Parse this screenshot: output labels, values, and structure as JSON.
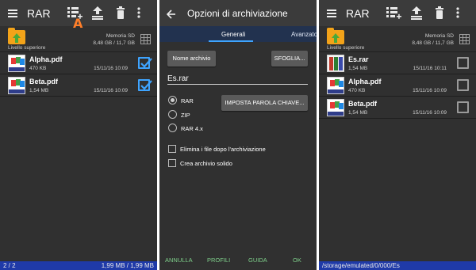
{
  "screen1": {
    "title": "RAR",
    "annotation_letter": "A",
    "up_label": "Livello superiore",
    "memory_label": "Memoria SD",
    "memory_value": "8,48 GB / 11,7 GB",
    "files": [
      {
        "name": "Alpha.pdf",
        "size": "470 KB",
        "date": "15/11/16 10:09",
        "checked": true
      },
      {
        "name": "Beta.pdf",
        "size": "1,54 MB",
        "date": "15/11/16 10:09",
        "checked": true
      }
    ],
    "status_left": "2 / 2",
    "status_right": "1,99 MB / 1,99 MB"
  },
  "screen2": {
    "title": "Opzioni di archiviazione",
    "tabs": [
      "Generali",
      "Avanzato"
    ],
    "filename_button": "Nome archivio",
    "browse_button": "SFOGLIA...",
    "archive_name": "Es.rar",
    "formats": [
      {
        "label": "RAR",
        "selected": true
      },
      {
        "label": "ZIP",
        "selected": false
      },
      {
        "label": "RAR 4.x",
        "selected": false
      }
    ],
    "password_button": "IMPOSTA PAROLA CHIAVE...",
    "options": [
      {
        "label": "Elimina i file dopo l'archiviazione",
        "checked": false
      },
      {
        "label": "Crea archivio solido",
        "checked": false
      }
    ],
    "actions": [
      "ANNULLA",
      "PROFILI",
      "GUIDA",
      "OK"
    ]
  },
  "screen3": {
    "title": "RAR",
    "up_label": "Livello superiore",
    "memory_label": "Memoria SD",
    "memory_value": "8,48 GB / 11,7 GB",
    "files": [
      {
        "name": "Es.rar",
        "size": "1,54 MB",
        "date": "15/11/16 10:11",
        "checked": false,
        "type": "rar"
      },
      {
        "name": "Alpha.pdf",
        "size": "470 KB",
        "date": "15/11/16 10:09",
        "checked": false,
        "type": "pdf"
      },
      {
        "name": "Beta.pdf",
        "size": "1,54 MB",
        "date": "15/11/16 10:09",
        "checked": false,
        "type": "pdf"
      }
    ],
    "status_path": "/storage/emulated/0/000/Es"
  },
  "colors": {
    "background": "#303030",
    "appbar": "#3b3b3b",
    "statusbar": "#1f3aa8",
    "accent": "#3ea4ff",
    "annotation": "#ff7f2a",
    "action_text": "#7ecf8a"
  },
  "icons": [
    "menu-icon",
    "add-to-archive-icon",
    "extract-icon",
    "delete-icon",
    "more-vert-icon",
    "folder-up-icon",
    "grid-view-icon",
    "back-arrow-icon",
    "checkbox-icon"
  ]
}
